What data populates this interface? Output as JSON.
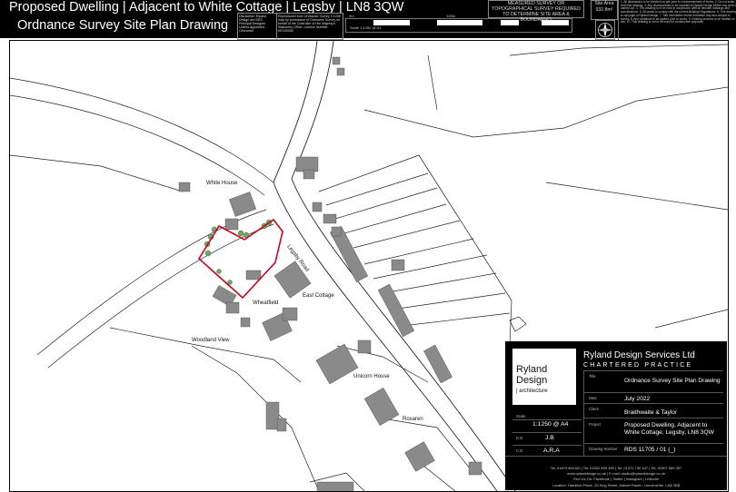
{
  "header": {
    "line1_title": "Proposed Dwelling | Adjacent to White Cottage | Legsby | LN8 3QW",
    "line2_title": "Ordnance Survey Site Plan Drawing",
    "copyright_note": "Disclaimer: Ryland Design are BDS Principal Designer Unless Appointed Otherwise",
    "reproduction_note": "Reproduced from Ordnance Survey 1:1250 map by permission of Ordnance Survey on behalf of the Controller of Her Majesty's Stationery Office. Licence Number AR100050",
    "scale_label_left": "0m",
    "scale_label_mid": "125m",
    "scale_note": "Scale 1:1250 @ A4",
    "survey_note": "MEASURED SURVEY OR TOPOGRAPHICAL SURVEY REQUIRED TO DETERMINE SITE AREA & BOUNDARIES",
    "site_area_label": "Site Area",
    "site_area_value": "932.8m²",
    "notes_text": "1. All dimensions to be checked on site prior to commencement of works. 2. Do not scale from this drawing. 3. Any discrepancies to be reported to Ryland Design before any work is carried out. 4. This drawing is to be read in conjunction with all relevant drawings and specifications. 5. All works to comply with the current Building Regulations. 6. This drawing is copyright of Ryland Design. 7. Site boundaries shown indicative only and subject to survey. 8. Any variations to be agreed prior to works. 9. Existing services to be located on site. 10. This drawing is not to be used for construction purposes."
  },
  "map": {
    "labels": {
      "white_house": "White House",
      "east_cottage": "East Cottage",
      "wheatfield": "Wheatfield",
      "woodland_view": "Woodland View",
      "unicorn_house": "Unicorn House",
      "rosaren": "Rosaren",
      "legsby_road": "Legsby Road"
    },
    "boundary_color": "#d0021b"
  },
  "title_block": {
    "logo_line1": "Ryland",
    "logo_line2": "Design",
    "logo_sub": "| architecture",
    "company": "Ryland Design Services Ltd",
    "chartered": "CHARTERED PRACTICE",
    "title_label": "Title",
    "title_value": "Ordnance Survey Site Plan Drawing",
    "date_label": "Date",
    "date_value": "July 2022",
    "client_label": "Client",
    "client_value": "Braithwaite & Taylor",
    "project_label": "Project",
    "project_value": "Proposed Dwelling, Adjacent to White Cottage, Legsby, LN8 3QW",
    "drawing_label": "Drawing Number",
    "drawing_value": "RDS 11705 / 01 (_)",
    "scale_label": "Scale",
    "scale_value": "1:1250 @ A4",
    "db_label": "D.B",
    "db_value": "J.B",
    "cb_label": "C.B",
    "cb_value": "A.R.A",
    "contact_line1": "Tel: 01673 860100 | Tel: 01522 899 390 | Tel: 01472 730 447 | Tel: 01507 589 057",
    "contact_line2": "www.rylanddesign.co.uk | E-mail: studio@rylanddesign.co.uk",
    "contact_line3": "Find Us On: Facebook | Twitter | Instagram | LinkedIn",
    "contact_line4": "Location: Hamilton Place, 25 King Street, Market Rasen, Lincolnshire, LN8 3BB"
  }
}
